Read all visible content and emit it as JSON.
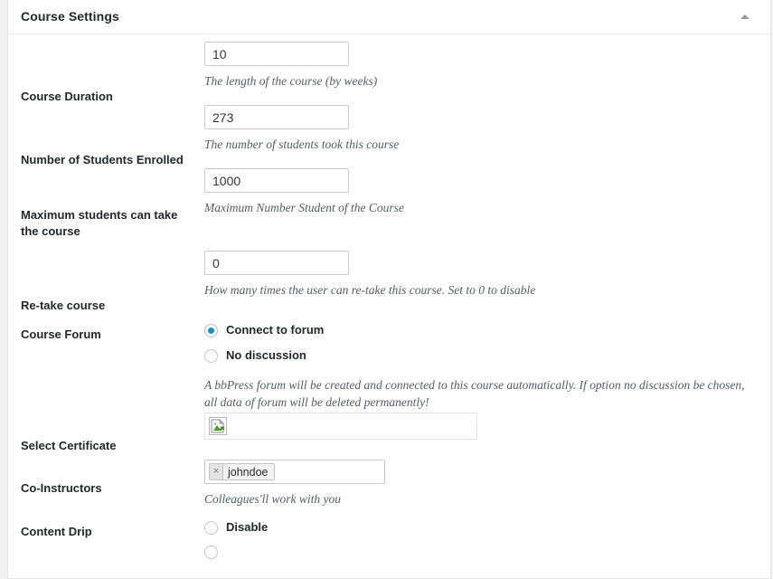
{
  "panel": {
    "title": "Course Settings",
    "toggle_icon": "caret-up-icon"
  },
  "fields": {
    "duration": {
      "label": "Course Duration",
      "value": "10",
      "description": "The length of the course (by weeks)"
    },
    "enrolled": {
      "label": "Number of Students Enrolled",
      "value": "273",
      "description": "The number of students took this course"
    },
    "maximum": {
      "label": "Maximum students can take the course",
      "value": "1000",
      "description": "Maximum Number Student of the Course"
    },
    "retake": {
      "label": "Re-take course",
      "value": "0",
      "description": "How many times the user can re-take this course. Set to 0 to disable"
    },
    "forum": {
      "label": "Course Forum",
      "options": [
        {
          "label": "Connect to forum",
          "checked": true
        },
        {
          "label": "No discussion",
          "checked": false
        }
      ],
      "description": "A bbPress forum will be created and connected to this course automatically. If option no discussion be chosen, all data of forum will be deleted permanently!"
    },
    "certificate": {
      "label": "Select Certificate",
      "thumbnail_icon": "broken-image-icon"
    },
    "coinstructors": {
      "label": "Co-Instructors",
      "tokens": [
        {
          "name": "johndoe",
          "remove_icon": "close-icon",
          "remove_glyph": "×"
        }
      ],
      "description": "Colleagues'll work with you"
    },
    "contentdrip": {
      "label": "Content Drip",
      "options": [
        {
          "label": "Disable",
          "checked": false
        }
      ]
    }
  },
  "colors": {
    "page_background": "#f1f1f1",
    "panel_background": "#ffffff",
    "panel_border": "#e5e5e5",
    "title_text": "#23282d",
    "label_text": "#23282d",
    "description_text": "#555d66",
    "input_border": "#cccccc",
    "radio_accent": "#1e8cbe",
    "token_background": "#f3f3f3"
  }
}
